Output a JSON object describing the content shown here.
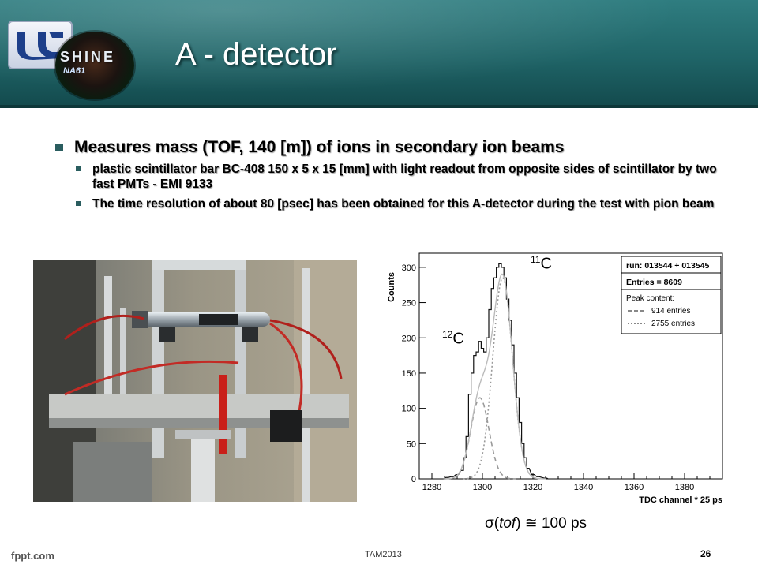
{
  "slide": {
    "title": "A - detector",
    "logo": {
      "shine_text": "SHINE",
      "na61_text": "NA61"
    },
    "bullets": [
      {
        "text": "Measures mass (TOF, 140 [m]) of ions in secondary ion beams",
        "sub": [
          "plastic scintillator bar BC-408 150 x 5 x 15 [mm] with light readout from opposite sides of scintillator by two fast PMTs - EMI 9133",
          "The time resolution of about 80 [psec] has been obtained for this A-detector during the test with pion beam"
        ]
      }
    ],
    "annotations": {
      "c11": {
        "sup": "11",
        "base": "C"
      },
      "c12": {
        "sup": "12",
        "base": "C"
      },
      "sigma_prefix": "σ(",
      "sigma_italic": "tof",
      "sigma_suffix": ") ≅ 100 ps"
    },
    "footer": {
      "left": "fppt.com",
      "center": "TAM2013",
      "page": "26"
    }
  },
  "chart_data": {
    "type": "line",
    "xlabel": "TDC channel * 25 ps",
    "ylabel": "Counts",
    "xlim": [
      1275,
      1395
    ],
    "ylim": [
      0,
      320
    ],
    "xticks": [
      1280,
      1300,
      1320,
      1340,
      1360,
      1380
    ],
    "yticks": [
      0,
      50,
      100,
      150,
      200,
      250,
      300
    ],
    "legend": {
      "placement": "top-right",
      "run": "run: 013544 + 013545",
      "entries": "Entries = 8609",
      "peak_header": "Peak content:",
      "peaks": [
        {
          "label": "914 entries",
          "style": "dashed"
        },
        {
          "label": "2755 entries",
          "style": "dotted"
        }
      ]
    },
    "histogram": {
      "x": [
        1286,
        1288,
        1290,
        1292,
        1293,
        1294,
        1295,
        1296,
        1297,
        1298,
        1299,
        1300,
        1301,
        1302,
        1303,
        1304,
        1305,
        1306,
        1307,
        1308,
        1309,
        1310,
        1311,
        1312,
        1313,
        1314,
        1315,
        1316,
        1317,
        1318,
        1320,
        1322,
        1325
      ],
      "y": [
        2,
        3,
        6,
        12,
        30,
        60,
        120,
        150,
        175,
        180,
        195,
        185,
        180,
        200,
        240,
        270,
        285,
        300,
        305,
        300,
        285,
        255,
        225,
        190,
        150,
        115,
        80,
        50,
        30,
        15,
        6,
        3,
        1
      ]
    },
    "fits": [
      {
        "name": "12C",
        "mean": 1299,
        "sigma": 3.6,
        "amplitude": 115,
        "style": "dashed"
      },
      {
        "name": "11C",
        "mean": 1308,
        "sigma": 3.9,
        "amplitude": 285,
        "style": "dotted"
      }
    ]
  }
}
